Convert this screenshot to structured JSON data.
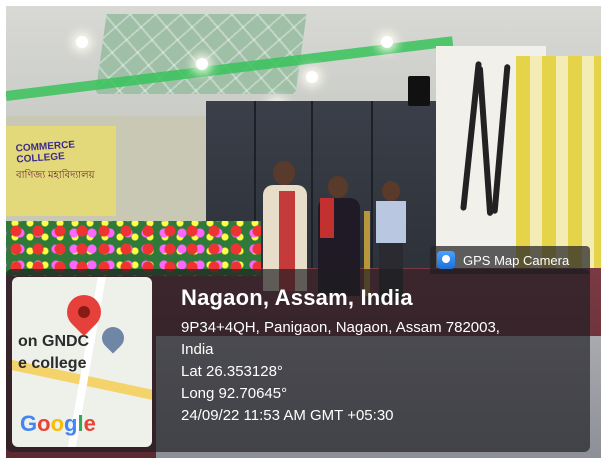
{
  "background_banner": {
    "line1": "COMMERCE COLLEGE",
    "line2": "বাণিজ্য মহাবিদ্যালয়"
  },
  "gps_tag": {
    "icon": "gps-map-camera-icon",
    "label": "GPS Map Camera"
  },
  "map_thumbnail": {
    "label_line1": "on GNDC",
    "label_line2": "e college",
    "brand": "Google"
  },
  "location": {
    "title": "Nagaon, Assam, India",
    "address_line1": "9P34+4QH, Panigaon, Nagaon, Assam 782003,",
    "address_line2": "India",
    "lat": "Lat 26.353128°",
    "long": "Long 92.70645°",
    "datetime": "24/09/22 11:53 AM GMT +05:30"
  },
  "colors": {
    "pin": "#e5403a",
    "overlay": "#1e1e22"
  }
}
